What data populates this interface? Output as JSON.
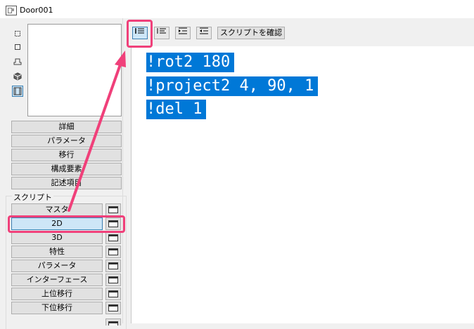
{
  "window": {
    "title": "Door001"
  },
  "left_toolbar": {
    "icons": [
      "select-icon",
      "rectangle-icon",
      "stamp-icon",
      "cube-icon",
      "film-icon"
    ]
  },
  "nav_buttons": [
    "詳細",
    "パラメータ",
    "移行",
    "構成要素",
    "記述項目"
  ],
  "script_group": {
    "label": "スクリプト",
    "items": [
      "マスタ",
      "2D",
      "3D",
      "特性",
      "パラメータ",
      "インターフェース",
      "上位移行",
      "下位移行"
    ],
    "active_item": "2D"
  },
  "editor_toolbar": {
    "icons": [
      "line-numbers-icon",
      "align-left-icon",
      "indent-icon",
      "outdent-icon"
    ],
    "check_script_label": "スクリプトを確認"
  },
  "editor": {
    "lines": [
      "!rot2 180",
      "!project2 4, 90, 1",
      "!del 1"
    ]
  },
  "colors": {
    "selection": "#0078d7",
    "annotation": "#f0407a",
    "active_button": "#cde6f7"
  }
}
